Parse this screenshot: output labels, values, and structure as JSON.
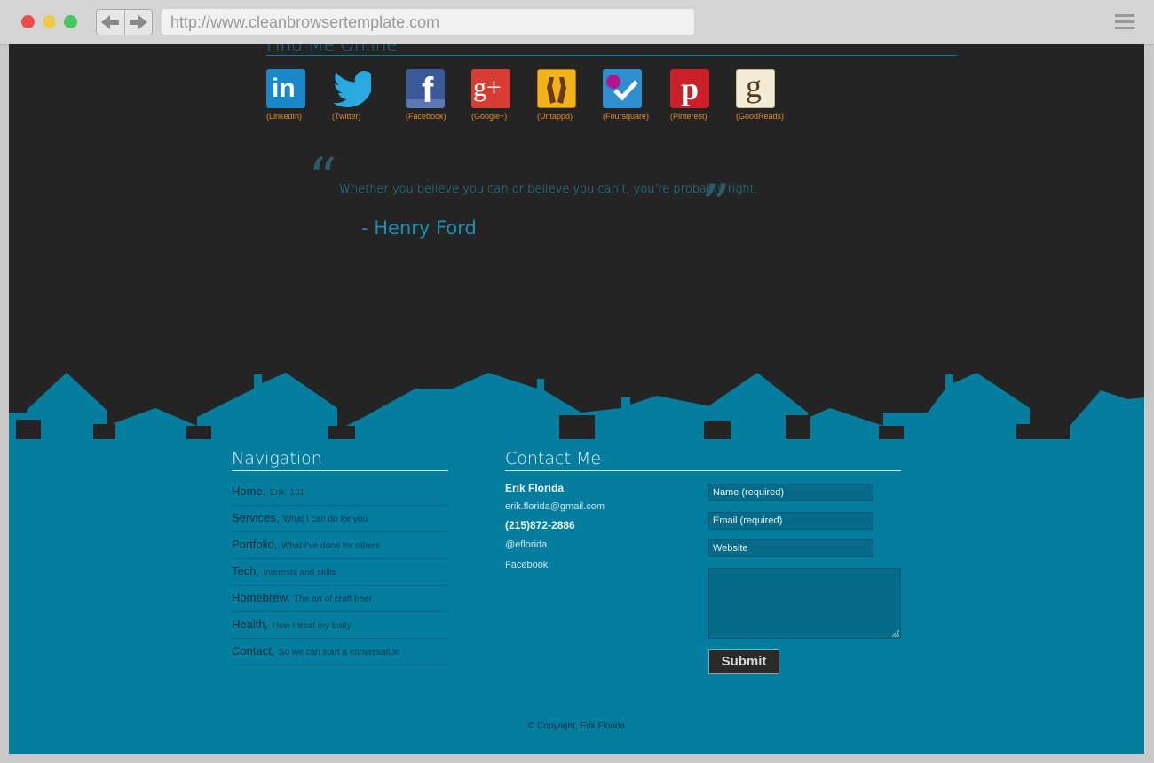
{
  "browser": {
    "url": "http://www.cleanbrowsertemplate.com"
  },
  "find_me": {
    "title": "Find Me Online",
    "items": [
      {
        "label": "(LinkedIn)",
        "icon": "linkedin-icon",
        "color": "#1a87c8"
      },
      {
        "label": "(Twitter)",
        "icon": "twitter-icon",
        "color": "#2aa9e0"
      },
      {
        "label": "(Facebook)",
        "icon": "facebook-icon",
        "color": "#3b5998"
      },
      {
        "label": "(Google+)",
        "icon": "google-plus-icon",
        "color": "#d73d32"
      },
      {
        "label": "(Untappd)",
        "icon": "untappd-icon",
        "color": "#f2b21a"
      },
      {
        "label": "(Foursquare)",
        "icon": "foursquare-icon",
        "color": "#2d8fd0"
      },
      {
        "label": "(Pinterest)",
        "icon": "pinterest-icon",
        "color": "#cb2027"
      },
      {
        "label": "(GoodReads)",
        "icon": "goodreads-icon",
        "color": "#f4ecd8"
      }
    ]
  },
  "quote": {
    "text": "Whether you believe you can or believe you can't, you're probably right.",
    "author": "- Henry Ford"
  },
  "navigation": {
    "title": "Navigation",
    "items": [
      {
        "main": "Home,",
        "sub": "Erik: 101"
      },
      {
        "main": "Services,",
        "sub": "What I can do for you"
      },
      {
        "main": "Portfolio,",
        "sub": "What I've done for others"
      },
      {
        "main": "Tech,",
        "sub": "Interests and skills"
      },
      {
        "main": "Homebrew,",
        "sub": "The art of craft beer"
      },
      {
        "main": "Health,",
        "sub": "How I treat my body"
      },
      {
        "main": "Contact,",
        "sub": "So we can start a conversation"
      }
    ]
  },
  "contact": {
    "title": "Contact Me",
    "name": "Erik Florida",
    "email": "erik.florida@gmail.com",
    "phone": "(215)872-2886",
    "twitter": "@eflorida",
    "facebook": "Facebook",
    "form": {
      "name_placeholder": "Name (required)",
      "email_placeholder": "Email (required)",
      "website_placeholder": "Website",
      "submit_label": "Submit"
    }
  },
  "footer": {
    "copyright": "© Copyright, Erik Florida"
  },
  "colors": {
    "footer_bg": "#057d9e",
    "page_bg": "#242424",
    "accent": "#1a8fb4",
    "icon_caption": "#e88c1f"
  }
}
